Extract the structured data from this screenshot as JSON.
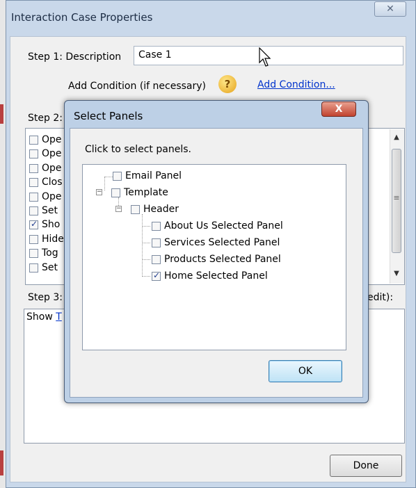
{
  "main_dialog": {
    "title": "Interaction Case Properties",
    "close_glyph": "✕",
    "step1_label": "Step 1: Description",
    "description_value": "Case 1",
    "add_condition_label": "Add Condition (if necessary)",
    "add_condition_link": "Add Condition...",
    "help_glyph": "?",
    "step2_label": "Step 2:",
    "actions": [
      {
        "label": "Ope",
        "checked": false
      },
      {
        "label": "Ope",
        "checked": false
      },
      {
        "label": "Ope",
        "checked": false
      },
      {
        "label": "Clos",
        "checked": false
      },
      {
        "label": "Ope",
        "checked": false
      },
      {
        "label": "Set",
        "checked": false
      },
      {
        "label": "Sho",
        "checked": true
      },
      {
        "label": "Hide",
        "checked": false
      },
      {
        "label": "Tog",
        "checked": false
      },
      {
        "label": "Set",
        "checked": false
      }
    ],
    "step3_label": "Step 3:",
    "step3_suffix": "edit):",
    "step3_text": "Show",
    "step3_link": "T",
    "done_label": "Done",
    "scroll_up_glyph": "▲",
    "scroll_down_glyph": "▼",
    "scroll_grip_glyph": "≡"
  },
  "select_panels": {
    "title": "Select Panels",
    "close_glyph": "X",
    "instruction": "Click to select panels.",
    "tree": [
      {
        "label": "Email Panel",
        "checked": false
      },
      {
        "label": "Template",
        "checked": false,
        "expander": "−"
      },
      {
        "label": "Header",
        "checked": false,
        "expander": "−"
      },
      {
        "label": "About Us Selected Panel",
        "checked": false
      },
      {
        "label": "Services Selected Panel",
        "checked": false
      },
      {
        "label": "Products Selected Panel",
        "checked": false
      },
      {
        "label": "Home Selected Panel",
        "checked": true
      }
    ],
    "ok_label": "OK"
  },
  "colors": {
    "frame": "#c9d8ea",
    "link": "#0033cc",
    "close_red": "#c1432f"
  }
}
